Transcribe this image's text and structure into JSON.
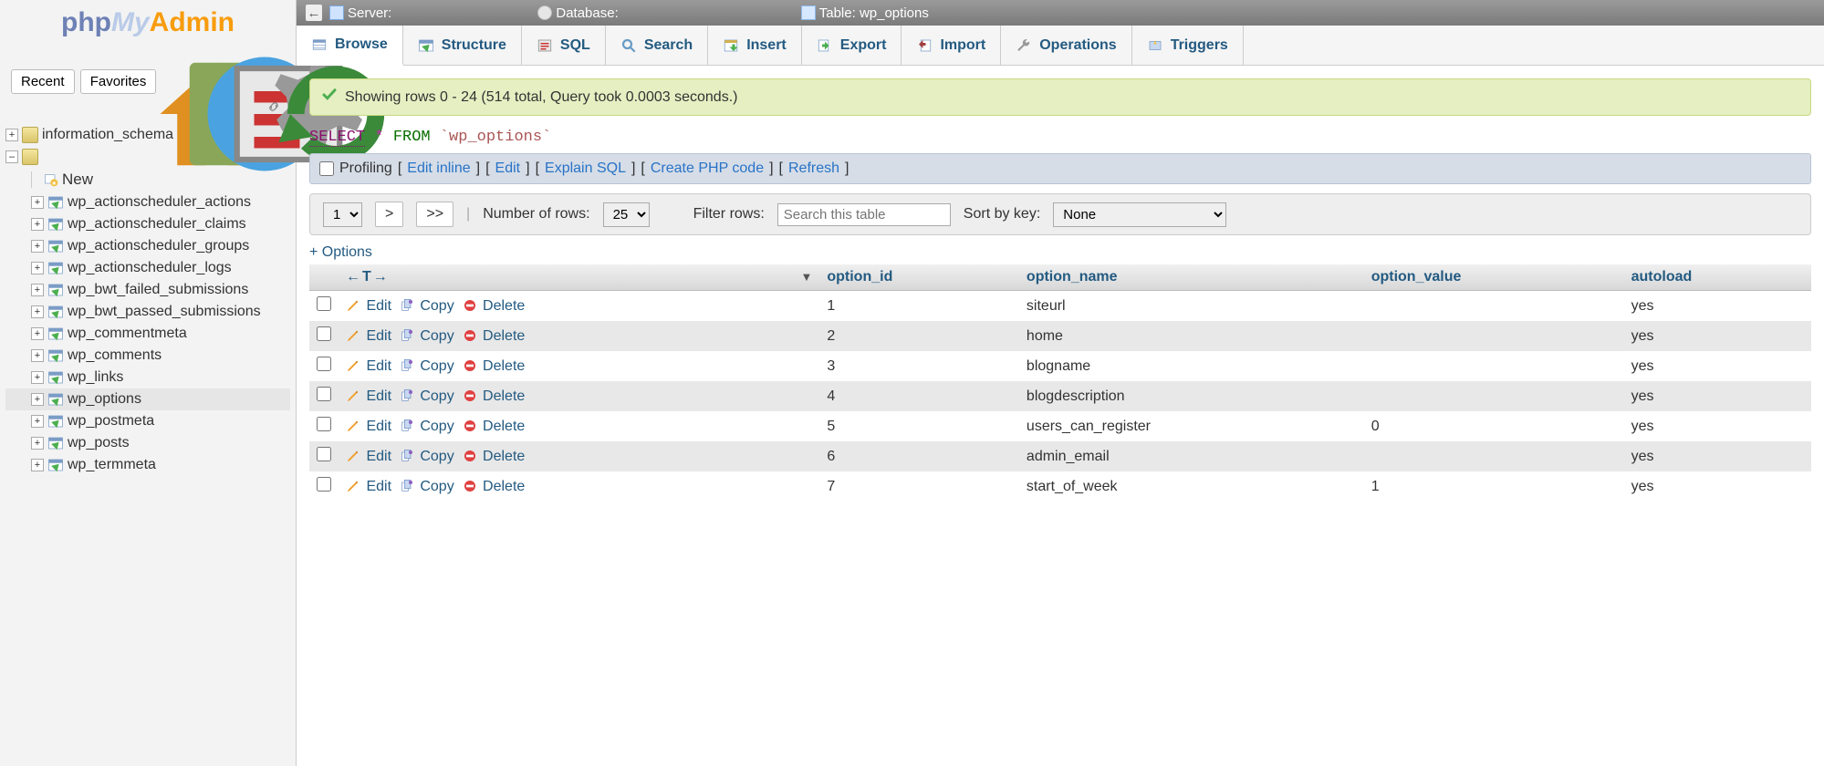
{
  "logo": {
    "p1": "php",
    "p2": "My",
    "p3": "Admin"
  },
  "sidebar": {
    "recent": "Recent",
    "favorites": "Favorites",
    "root_db": "information_schema",
    "new_label": "New",
    "tables": [
      {
        "name": "wp_actionscheduler_actions",
        "active": false
      },
      {
        "name": "wp_actionscheduler_claims",
        "active": false
      },
      {
        "name": "wp_actionscheduler_groups",
        "active": false
      },
      {
        "name": "wp_actionscheduler_logs",
        "active": false
      },
      {
        "name": "wp_bwt_failed_submissions",
        "active": false
      },
      {
        "name": "wp_bwt_passed_submissions",
        "active": false
      },
      {
        "name": "wp_commentmeta",
        "active": false
      },
      {
        "name": "wp_comments",
        "active": false
      },
      {
        "name": "wp_links",
        "active": false
      },
      {
        "name": "wp_options",
        "active": true
      },
      {
        "name": "wp_postmeta",
        "active": false
      },
      {
        "name": "wp_posts",
        "active": false
      },
      {
        "name": "wp_termmeta",
        "active": false
      }
    ]
  },
  "breadcrumb": {
    "server_label": "Server:",
    "database_label": "Database:",
    "table_label": "Table: wp_options"
  },
  "tabs": [
    {
      "key": "browse",
      "label": "Browse",
      "active": true
    },
    {
      "key": "structure",
      "label": "Structure",
      "active": false
    },
    {
      "key": "sql",
      "label": "SQL",
      "active": false
    },
    {
      "key": "search",
      "label": "Search",
      "active": false
    },
    {
      "key": "insert",
      "label": "Insert",
      "active": false
    },
    {
      "key": "export",
      "label": "Export",
      "active": false
    },
    {
      "key": "import",
      "label": "Import",
      "active": false
    },
    {
      "key": "operations",
      "label": "Operations",
      "active": false
    },
    {
      "key": "triggers",
      "label": "Triggers",
      "active": false
    }
  ],
  "success_msg": "Showing rows 0 - 24 (514 total, Query took 0.0003 seconds.)",
  "query": {
    "select": "SELECT",
    "star": "*",
    "from": "FROM",
    "table": "`wp_options`"
  },
  "querybar": {
    "profiling": "Profiling",
    "edit_inline": "Edit inline",
    "edit": "Edit",
    "explain": "Explain SQL",
    "create_php": "Create PHP code",
    "refresh": "Refresh"
  },
  "navrow": {
    "page_value": "1",
    "next": ">",
    "last": ">>",
    "num_rows_label": "Number of rows:",
    "num_rows_value": "25",
    "filter_label": "Filter rows:",
    "search_placeholder": "Search this table",
    "sort_label": "Sort by key:",
    "sort_value": "None"
  },
  "opts_link": "+ Options",
  "table": {
    "columns": [
      "option_id",
      "option_name",
      "option_value",
      "autoload"
    ],
    "actions": {
      "edit": "Edit",
      "copy": "Copy",
      "delete": "Delete"
    },
    "rows": [
      {
        "option_id": "1",
        "option_name": "siteurl",
        "option_value": "",
        "autoload": "yes"
      },
      {
        "option_id": "2",
        "option_name": "home",
        "option_value": "",
        "autoload": "yes"
      },
      {
        "option_id": "3",
        "option_name": "blogname",
        "option_value": "",
        "autoload": "yes"
      },
      {
        "option_id": "4",
        "option_name": "blogdescription",
        "option_value": "",
        "autoload": "yes"
      },
      {
        "option_id": "5",
        "option_name": "users_can_register",
        "option_value": "0",
        "autoload": "yes"
      },
      {
        "option_id": "6",
        "option_name": "admin_email",
        "option_value": "",
        "autoload": "yes"
      },
      {
        "option_id": "7",
        "option_name": "start_of_week",
        "option_value": "1",
        "autoload": "yes"
      }
    ]
  }
}
